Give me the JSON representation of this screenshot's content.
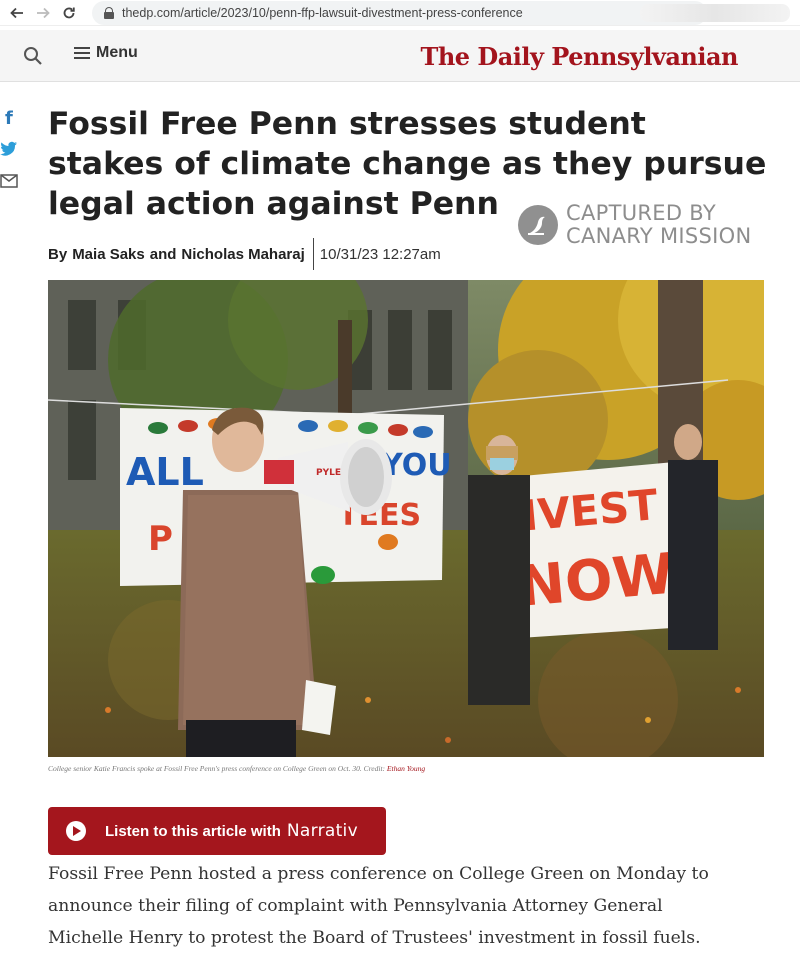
{
  "browser": {
    "url": "thedp.com/article/2023/10/penn-ffp-lawsuit-divestment-press-conference"
  },
  "header": {
    "menu_label": "Menu",
    "masthead": "The Daily Pennsylvanian",
    "brand_color": "#a3141d"
  },
  "social": {
    "icons": [
      "facebook-icon",
      "twitter-icon",
      "email-icon"
    ]
  },
  "article": {
    "headline": "Fossil Free Penn stresses student stakes of climate change as they pursue legal action against Penn",
    "byline_prefix": "By",
    "author1": "Maia Saks",
    "byline_and": "and",
    "author2": "Nicholas Maharaj",
    "date": "10/31/23 12:27am",
    "caption_text": "College senior Katie Francis spoke at Fossil Free Penn's press conference on College Green on Oct. 30. Credit: ",
    "caption_credit": "Ethan Young",
    "body": "Fossil Free Penn hosted a press conference on College Green on Monday to announce their filing of complaint with Pennsylvania Attorney General Michelle Henry to protest the Board of Trustees' investment in fossil fuels."
  },
  "watermark": {
    "line1": "CAPTURED BY",
    "line2": "CANARY MISSION"
  },
  "photo": {
    "banner_left_text1": "ALL",
    "banner_left_text2": "ON YOU",
    "banner_left_text3": "P",
    "banner_left_text4": "TEES",
    "megaphone_brand": "PYLE",
    "banner_right_line1": "DIVEST",
    "banner_right_line2": "NOW"
  },
  "listen": {
    "label": "Listen to this article with",
    "brand": "Narrativ",
    "color": "#a4161d"
  }
}
